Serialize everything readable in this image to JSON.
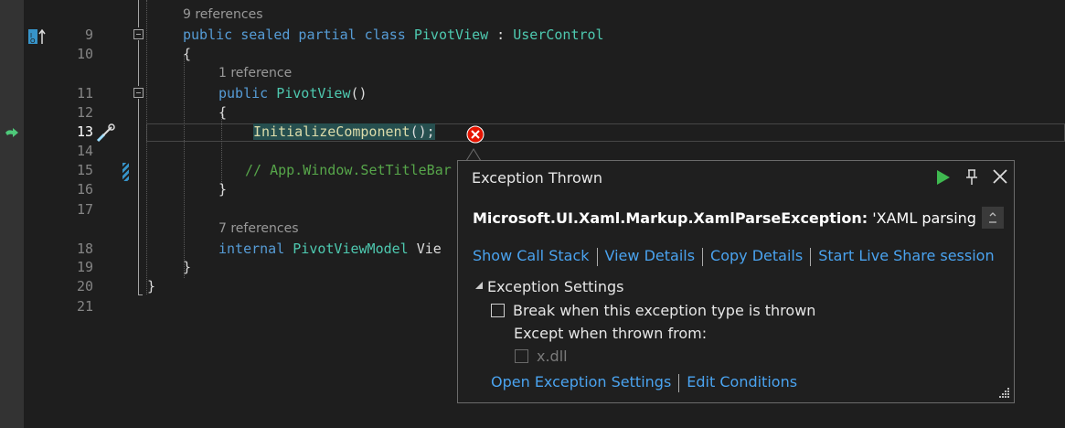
{
  "code_lines": [
    {
      "num": "9",
      "lens": "9 references",
      "tokens": [
        [
          "kw",
          "public sealed partial class "
        ],
        [
          "ty",
          "PivotView"
        ],
        [
          "pl",
          " : "
        ],
        [
          "ty",
          "UserControl"
        ]
      ]
    },
    {
      "num": "10",
      "tokens": [
        [
          "pl",
          "{"
        ]
      ]
    },
    {
      "num": "11",
      "lens": "1 reference",
      "tokens": [
        [
          "kw",
          "public "
        ],
        [
          "ty",
          "PivotView"
        ],
        [
          "pl",
          "()"
        ]
      ]
    },
    {
      "num": "12",
      "tokens": [
        [
          "pl",
          "{"
        ]
      ]
    },
    {
      "num": "13",
      "tokens": [
        [
          "fn",
          "InitializeComponent"
        ],
        [
          "pl",
          "();"
        ]
      ]
    },
    {
      "num": "14",
      "tokens": []
    },
    {
      "num": "15",
      "tokens": [
        [
          "cm",
          "// App.Window.SetTitleBar"
        ]
      ]
    },
    {
      "num": "16",
      "tokens": [
        [
          "pl",
          "}"
        ]
      ]
    },
    {
      "num": "17",
      "tokens": []
    },
    {
      "num": "18",
      "lens": "7 references",
      "tokens": [
        [
          "kw",
          "internal "
        ],
        [
          "ty",
          "PivotViewModel"
        ],
        [
          "pl",
          " Vie"
        ]
      ]
    },
    {
      "num": "19",
      "tokens": [
        [
          "pl",
          "}"
        ]
      ]
    },
    {
      "num": "20",
      "tokens": [
        [
          "pl",
          "}"
        ]
      ]
    },
    {
      "num": "21",
      "tokens": []
    }
  ],
  "exception": {
    "title": "Exception Thrown",
    "type": "Microsoft.UI.Xaml.Markup.XamlParseException:",
    "message": " 'XAML parsing",
    "links": [
      "Show Call Stack",
      "View Details",
      "Copy Details",
      "Start Live Share session"
    ],
    "settings_header": "Exception Settings",
    "break_label": "Break when this exception type is thrown",
    "except_label": "Except when thrown from:",
    "module_label": "x.dll",
    "open_settings": "Open Exception Settings",
    "edit_conditions": "Edit Conditions"
  },
  "colors": {
    "keyword": "#569cd6",
    "type": "#4ec9b0",
    "method": "#dcdcaa",
    "comment": "#57a64a",
    "link": "#4aa3ef",
    "error": "#e51400",
    "continue": "#3fb950"
  },
  "icons": [
    "breakpoint-arrow-icon",
    "current-statement-arrow-icon",
    "quick-actions-screwdriver-icon",
    "error-icon",
    "continue-icon",
    "pin-icon",
    "close-icon",
    "resize-grip-icon"
  ]
}
